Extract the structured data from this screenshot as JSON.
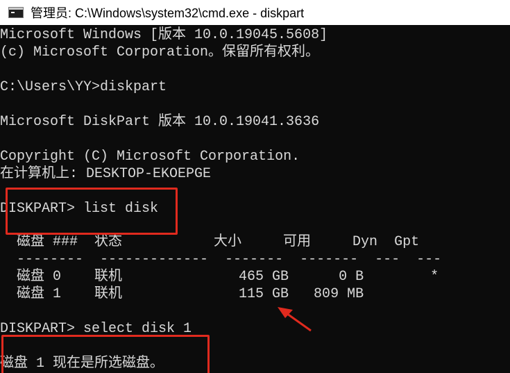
{
  "window": {
    "title": "管理员: C:\\Windows\\system32\\cmd.exe - diskpart",
    "icon": "cmd-icon"
  },
  "console": {
    "lines": [
      "Microsoft Windows [版本 10.0.19045.5608]",
      "(c) Microsoft Corporation。保留所有权利。",
      "",
      "C:\\Users\\YY>diskpart",
      "",
      "Microsoft DiskPart 版本 10.0.19041.3636",
      "",
      "Copyright (C) Microsoft Corporation.",
      "在计算机上: DESKTOP-EKOEPGE",
      "",
      "DISKPART> list disk",
      "",
      "  磁盘 ###  状态           大小     可用     Dyn  Gpt",
      "  --------  -------------  -------  -------  ---  ---",
      "  磁盘 0    联机              465 GB      0 B        *",
      "  磁盘 1    联机              115 GB   809 MB",
      "",
      "DISKPART> select disk 1",
      "",
      "磁盘 1 现在是所选磁盘。"
    ]
  },
  "annotations": {
    "highlight_color": "#e02a1e"
  }
}
